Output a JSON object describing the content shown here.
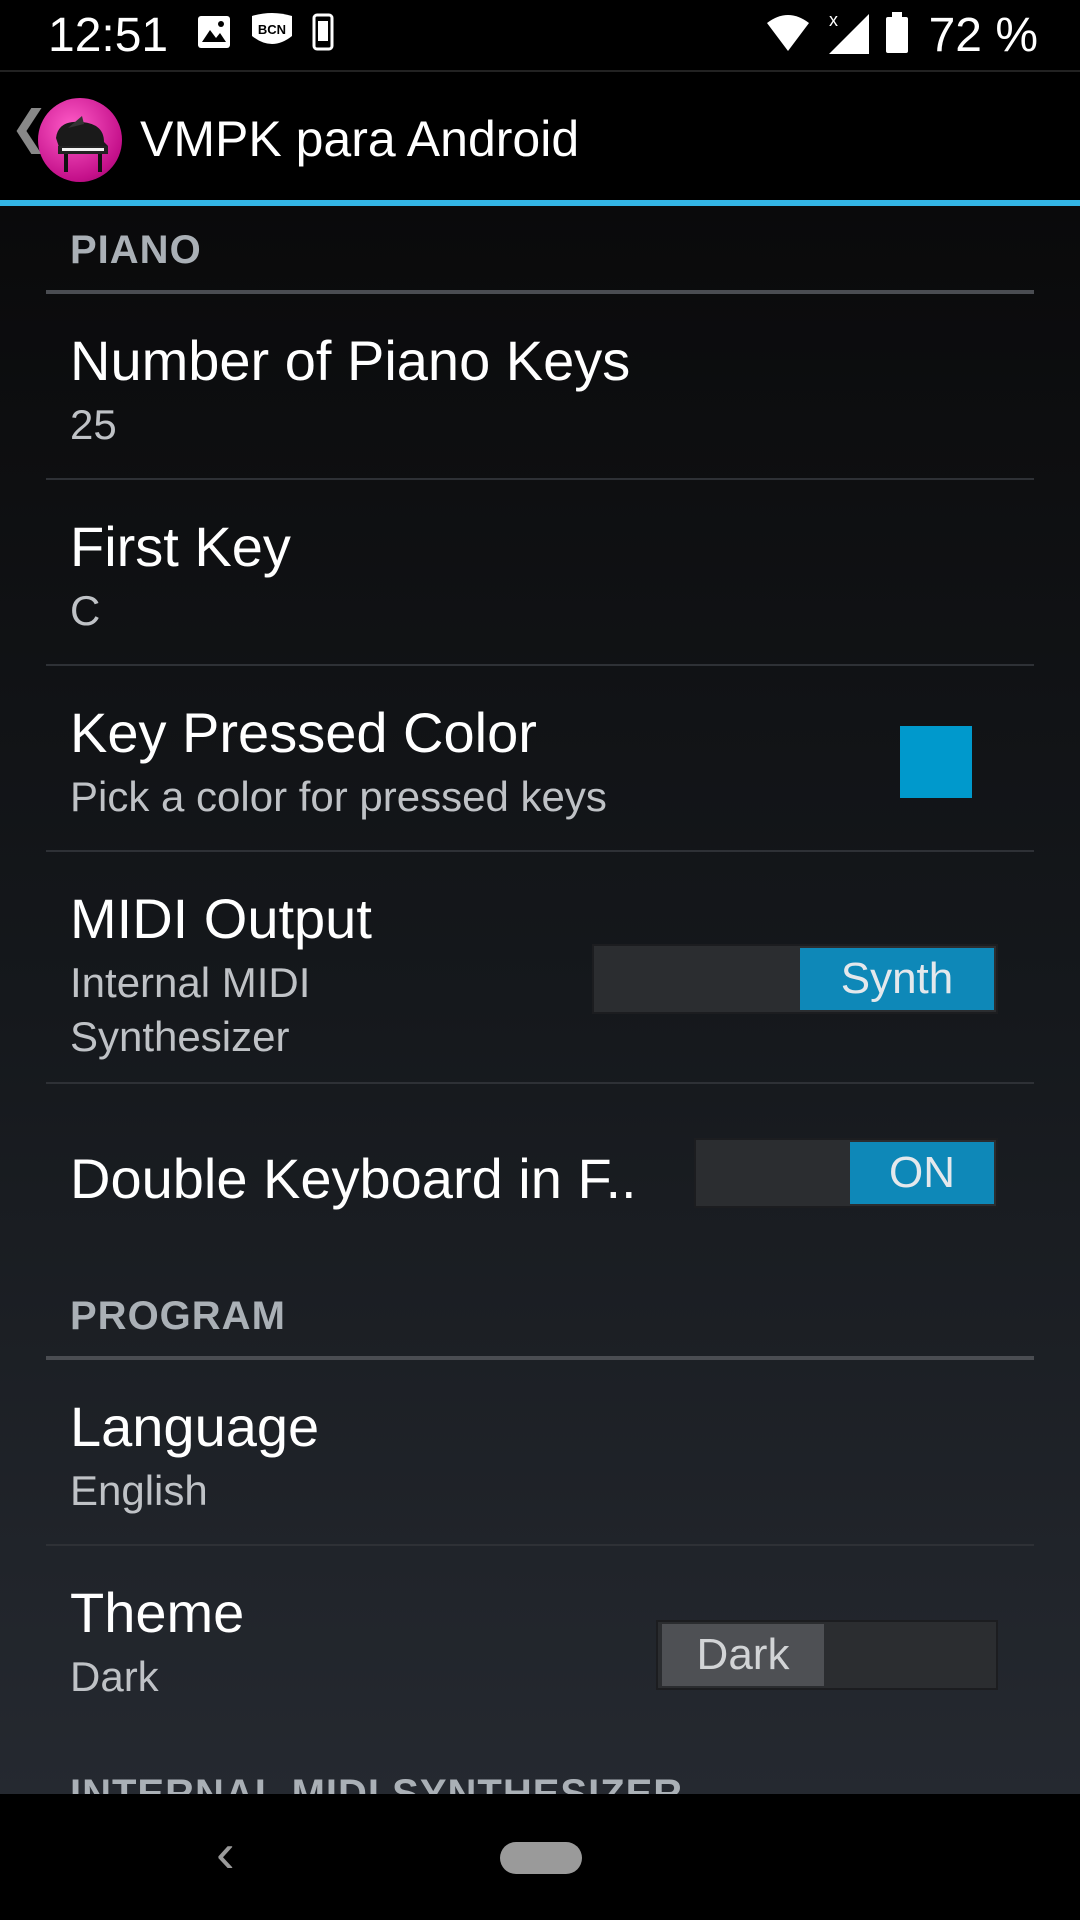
{
  "status_bar": {
    "time": "12:51",
    "badge_text": "BCN",
    "battery_percent": "72 %",
    "icons": [
      "image-icon",
      "bcn-badge-icon",
      "phone-icon",
      "wifi-icon",
      "signal-icon",
      "battery-icon"
    ]
  },
  "action_bar": {
    "title": "VMPK para Android",
    "accent_color": "#33b5e5"
  },
  "sections": [
    {
      "header": "PIANO",
      "items": [
        {
          "title": "Number of Piano Keys",
          "summary": "25"
        },
        {
          "title": "First Key",
          "summary": "C"
        },
        {
          "title": "Key Pressed Color",
          "summary": "Pick a color for pressed keys",
          "swatch_color": "#0099cc"
        },
        {
          "title": "MIDI Output",
          "summary_line1": "Internal MIDI",
          "summary_line2": "Synthesizer",
          "toggle_label": "Synth"
        },
        {
          "title": "Double Keyboard in F..",
          "toggle_label": "ON"
        }
      ]
    },
    {
      "header": "PROGRAM",
      "items": [
        {
          "title": "Language",
          "summary": "English"
        },
        {
          "title": "Theme",
          "summary": "Dark",
          "toggle_label": "Dark"
        }
      ]
    },
    {
      "header": "INTERNAL MIDI SYNTHESIZER"
    }
  ]
}
